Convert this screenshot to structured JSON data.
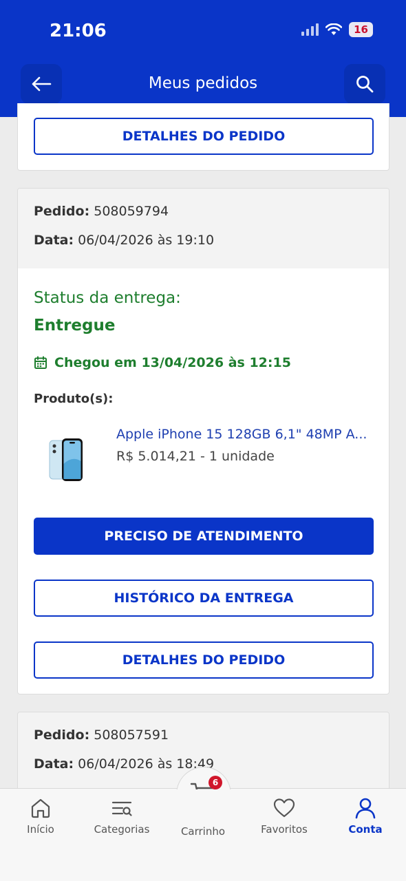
{
  "status_bar": {
    "time": "21:06",
    "battery": "16"
  },
  "header": {
    "title": "Meus pedidos"
  },
  "orders": [
    {
      "details_label": "DETALHES DO PEDIDO"
    },
    {
      "order_label": "Pedido:",
      "order_number": "508059794",
      "date_label": "Data:",
      "date": "06/04/2026 às 19:10",
      "status_label": "Status da entrega:",
      "status": "Entregue",
      "arrived": "Chegou em 13/04/2026 às 12:15",
      "products_label": "Produto(s):",
      "product": {
        "name": "Apple iPhone 15 128GB 6,1\" 48MP A...",
        "price": "R$ 5.014,21 - 1 unidade"
      },
      "support_label": "PRECISO DE ATENDIMENTO",
      "history_label": "HISTÓRICO DA ENTREGA",
      "details_label": "DETALHES DO PEDIDO"
    },
    {
      "order_label": "Pedido:",
      "order_number": "508057591",
      "date_label": "Data:",
      "date": "06/04/2026 às 18:49"
    }
  ],
  "bottom_nav": {
    "items": [
      {
        "label": "Início",
        "icon": "home-icon"
      },
      {
        "label": "Categorias",
        "icon": "categories-icon"
      },
      {
        "label": "Carrinho",
        "icon": "cart-icon",
        "badge": "6"
      },
      {
        "label": "Favoritos",
        "icon": "heart-icon"
      },
      {
        "label": "Conta",
        "icon": "user-icon",
        "active": true
      }
    ]
  },
  "colors": {
    "brand": "#0a35c8",
    "success": "#1e7e2e",
    "badge": "#d0162b"
  }
}
